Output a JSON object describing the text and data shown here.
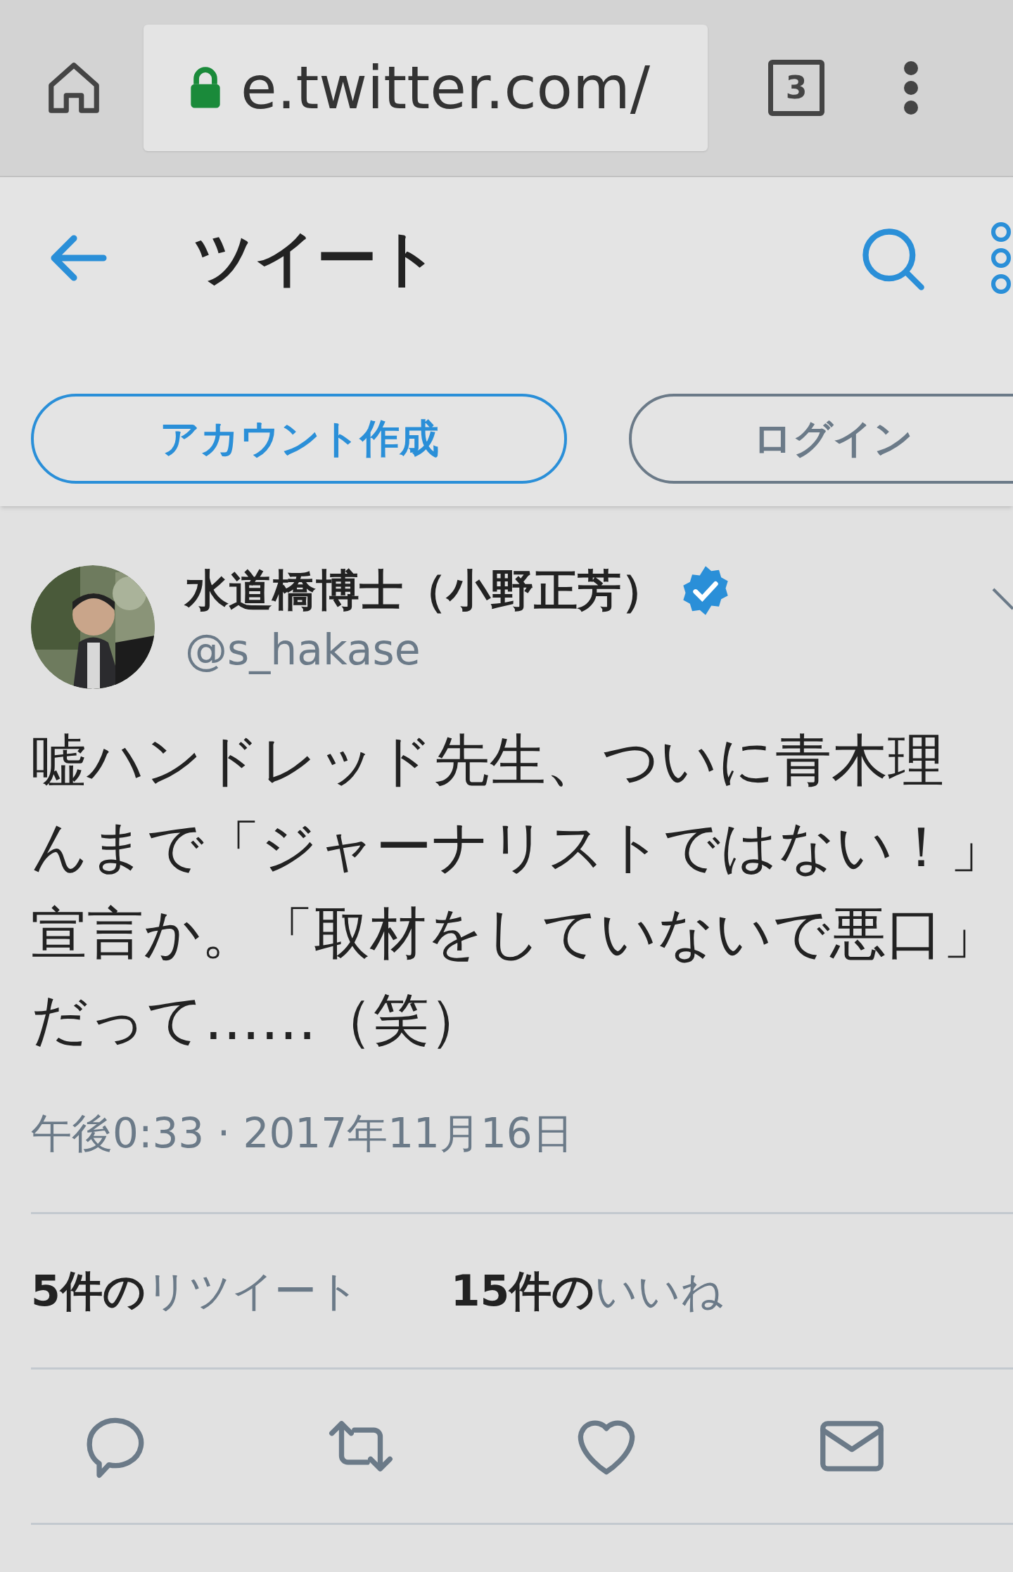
{
  "browser": {
    "url": "e.twitter.com/",
    "tab_count": "3"
  },
  "header": {
    "title": "ツイート"
  },
  "auth_buttons": [
    {
      "label": "アカウント作成",
      "kind": "primary"
    },
    {
      "label": "ログイン",
      "kind": "secondary"
    }
  ],
  "tweet": {
    "name": "水道橋博士（小野正芳）",
    "verified": true,
    "handle": "@s_hakase",
    "lines": [
      "嘘ハンドレッド先生、ついに青木理",
      "んまで「ジャーナリストではない！」",
      "宣言か。「取材をしていないで悪口」",
      "だって……（笑）"
    ],
    "timestamp": "午後0:33 · 2017年11月16日",
    "stats": [
      {
        "count": "5件の",
        "label": "リツイート"
      },
      {
        "count": "15件の",
        "label": "いいね"
      }
    ],
    "actions": [
      {
        "kind": "reply"
      },
      {
        "kind": "retweet"
      },
      {
        "kind": "like"
      },
      {
        "kind": "message"
      }
    ]
  }
}
